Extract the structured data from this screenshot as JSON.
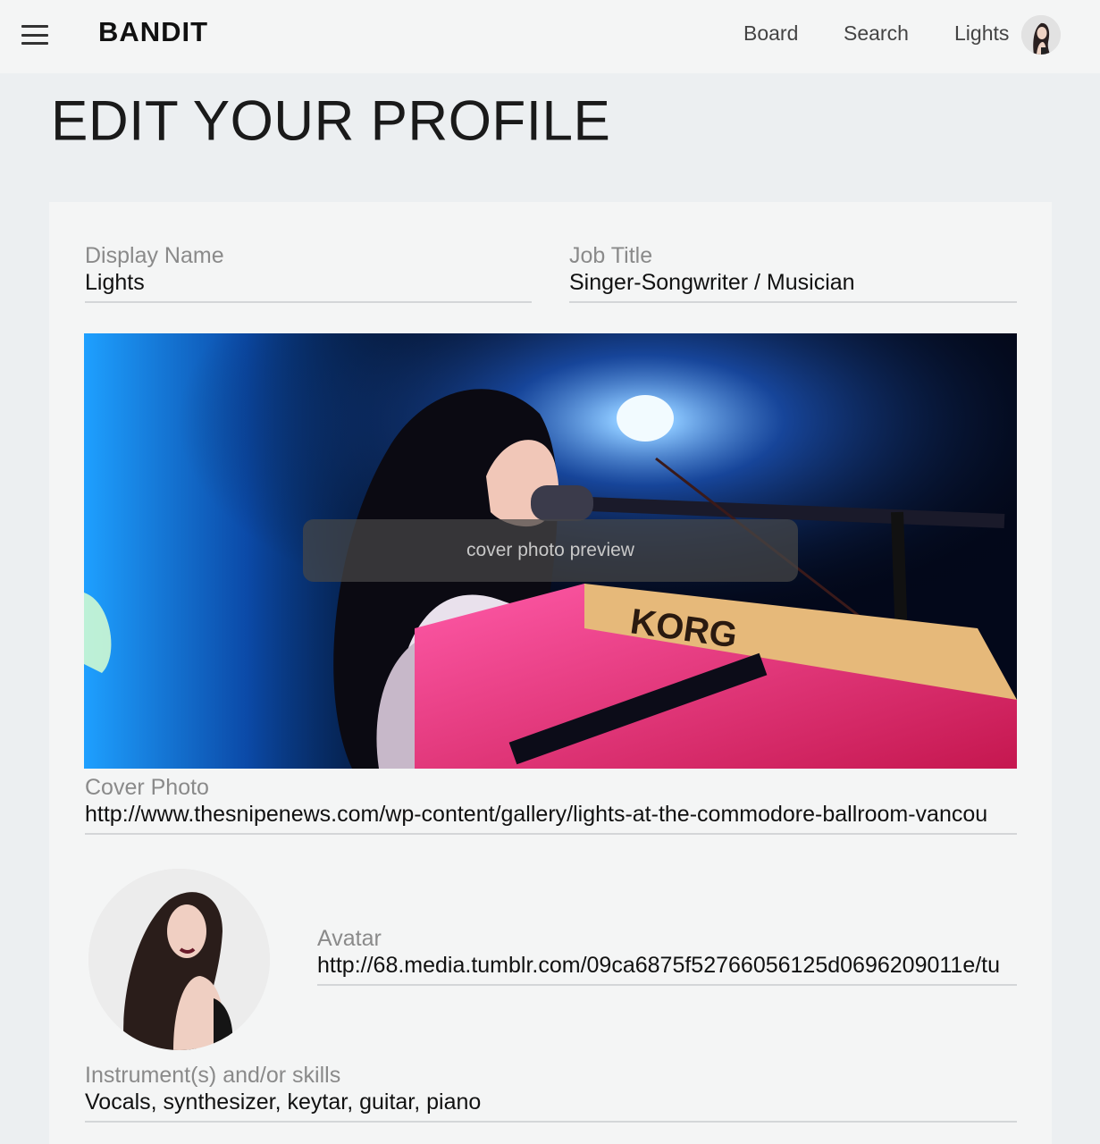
{
  "header": {
    "brand": "BANDIT",
    "nav": [
      {
        "label": "Board"
      },
      {
        "label": "Search"
      },
      {
        "label": "Lights"
      }
    ],
    "avatar_icon": "user-avatar-icon"
  },
  "page": {
    "title": "EDIT YOUR PROFILE"
  },
  "form": {
    "display_name": {
      "label": "Display Name",
      "value": "Lights"
    },
    "job_title": {
      "label": "Job Title",
      "value": "Singer-Songwriter / Musician"
    },
    "cover_preview_label": "cover photo preview",
    "cover_photo": {
      "label": "Cover Photo",
      "value": "http://www.thesnipenews.com/wp-content/gallery/lights-at-the-commodore-ballroom-vancou"
    },
    "avatar": {
      "label": "Avatar",
      "value": "http://68.media.tumblr.com/09ca6875f52766056125d0696209011e/tu"
    },
    "skills": {
      "label": "Instrument(s) and/or skills",
      "value": "Vocals, synthesizer, keytar, guitar, piano"
    }
  },
  "colors": {
    "page_bg": "#eceff1",
    "card_bg": "#f4f5f5",
    "label_gray": "#8a8a8a",
    "underline": "#d4d6d8"
  }
}
